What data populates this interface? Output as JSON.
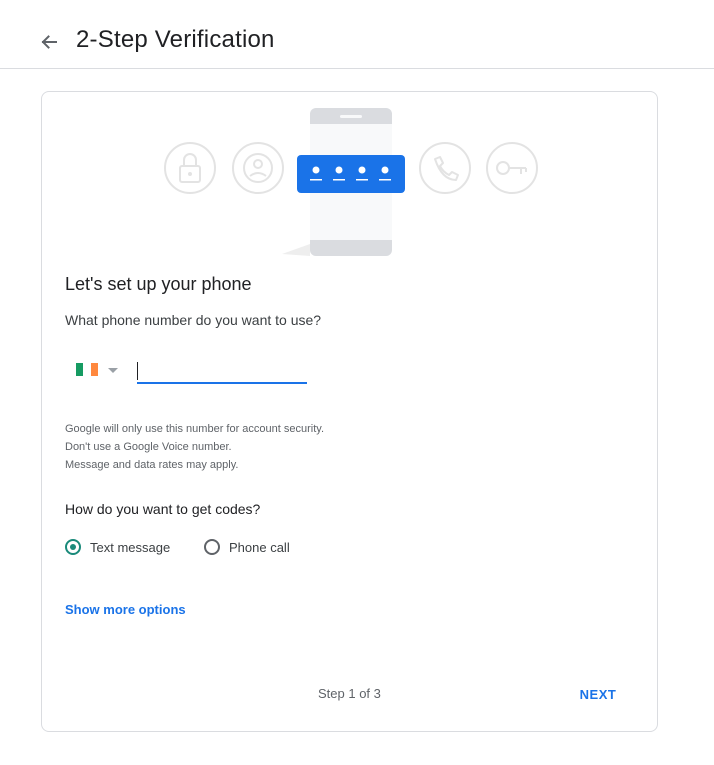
{
  "header": {
    "back_icon": "arrow-back-icon",
    "title": "2-Step Verification"
  },
  "illustration": {
    "icons": [
      "lock-icon",
      "account-icon",
      "phone-icon",
      "key-icon"
    ],
    "code_dots": 4,
    "accent_color": "#1a73e8"
  },
  "setup": {
    "title": "Let's set up your phone",
    "question": "What phone number do you want to use?",
    "country_flag": "Ireland",
    "flag_colors": [
      "#169b62",
      "#ffffff",
      "#ff883e"
    ],
    "phone_value": "",
    "phone_placeholder": "",
    "info": [
      "Google will only use this number for account security.",
      "Don't use a Google Voice number.",
      "Message and data rates may apply."
    ]
  },
  "codes": {
    "question": "How do you want to get codes?",
    "options": [
      {
        "label": "Text message",
        "selected": true
      },
      {
        "label": "Phone call",
        "selected": false
      }
    ]
  },
  "more_options": "Show more options",
  "footer": {
    "step": "Step 1 of 3",
    "next": "NEXT"
  }
}
